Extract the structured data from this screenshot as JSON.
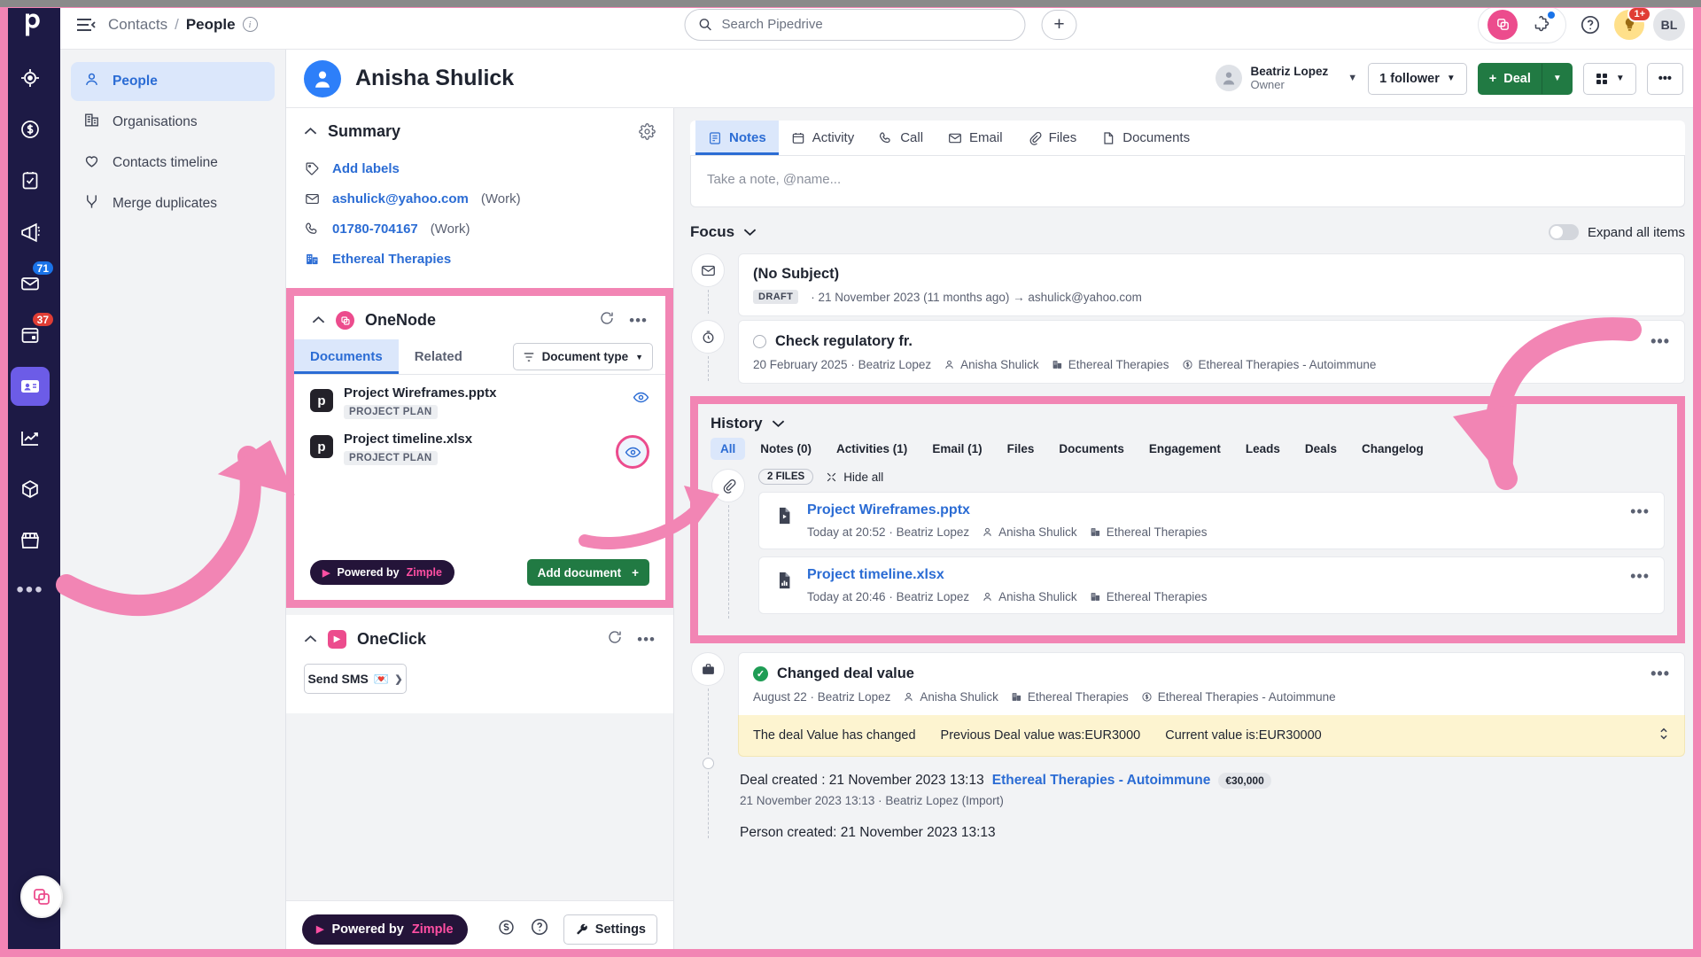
{
  "topbar": {
    "breadcrumb_parent": "Contacts",
    "breadcrumb_sep": "/",
    "breadcrumb_current": "People",
    "search_placeholder": "Search Pipedrive",
    "plus_label": "+",
    "help_label": "?",
    "notifications_badge": "1+",
    "user_initials": "BL"
  },
  "rail": {
    "badge_mail": "71",
    "badge_calendar": "37",
    "more_label": "•••"
  },
  "leftnav": {
    "items": [
      {
        "label": "People",
        "icon": "person-icon",
        "active": true
      },
      {
        "label": "Organisations",
        "icon": "building-icon",
        "active": false
      },
      {
        "label": "Contacts timeline",
        "icon": "heart-icon",
        "active": false
      },
      {
        "label": "Merge duplicates",
        "icon": "merge-icon",
        "active": false
      }
    ]
  },
  "person": {
    "name": "Anisha Shulick",
    "owner_name": "Beatriz Lopez",
    "owner_role": "Owner",
    "followers_label": "1 follower",
    "deal_label": "Deal",
    "deal_plus": "+"
  },
  "summary": {
    "title": "Summary",
    "add_labels": "Add labels",
    "email": "ashulick@yahoo.com",
    "email_type": "(Work)",
    "phone": "01780-704167",
    "phone_type": "(Work)",
    "organisation": "Ethereal Therapies"
  },
  "onenode": {
    "title": "OneNode",
    "tabs": [
      {
        "label": "Documents",
        "active": true
      },
      {
        "label": "Related",
        "active": false
      }
    ],
    "document_type_filter": "Document type",
    "documents": [
      {
        "name": "Project Wireframes.pptx",
        "tag": "PROJECT PLAN",
        "highlighted": false
      },
      {
        "name": "Project timeline.xlsx",
        "tag": "PROJECT PLAN",
        "highlighted": true
      }
    ],
    "powered_by_prefix": "Powered by",
    "powered_by_brand": "Zimple",
    "add_document": "Add document",
    "add_document_plus": "+"
  },
  "oneclick": {
    "title": "OneClick",
    "send_sms": "Send SMS",
    "send_sms_emoji": "💌"
  },
  "center_footer": {
    "powered_by_prefix": "Powered by",
    "powered_by_brand": "Zimple",
    "settings": "Settings"
  },
  "nav_tabs": [
    {
      "label": "Notes",
      "icon": "note-icon",
      "active": true
    },
    {
      "label": "Activity",
      "icon": "calendar-icon",
      "active": false
    },
    {
      "label": "Call",
      "icon": "phone-icon",
      "active": false
    },
    {
      "label": "Email",
      "icon": "envelope-icon",
      "active": false
    },
    {
      "label": "Files",
      "icon": "paperclip-icon",
      "active": false
    },
    {
      "label": "Documents",
      "icon": "document-icon",
      "active": false
    }
  ],
  "note_input": {
    "placeholder": "Take a note, @name..."
  },
  "focus": {
    "title": "Focus",
    "expand_all": "Expand all items",
    "items": [
      {
        "icon": "envelope-icon",
        "title": "(No Subject)",
        "tag": "DRAFT",
        "meta": "· 21 November 2023 (11 months ago) → ashulick@yahoo.com",
        "has_menu": false
      },
      {
        "icon": "clock-icon",
        "title": "Check regulatory fr.",
        "date": "20 February 2025 · Beatriz Lopez",
        "person": "Anisha Shulick",
        "org": "Ethereal Therapies",
        "deal": "Ethereal Therapies - Autoimmune",
        "has_menu": true
      }
    ]
  },
  "history": {
    "title": "History",
    "filters": [
      {
        "label": "All",
        "active": true
      },
      {
        "label": "Notes (0)",
        "active": false
      },
      {
        "label": "Activities (1)",
        "active": false
      },
      {
        "label": "Email (1)",
        "active": false
      },
      {
        "label": "Files",
        "active": false
      },
      {
        "label": "Documents",
        "active": false
      },
      {
        "label": "Engagement",
        "active": false
      },
      {
        "label": "Leads",
        "active": false
      },
      {
        "label": "Deals",
        "active": false
      },
      {
        "label": "Changelog",
        "active": false
      }
    ],
    "files_group": {
      "count_label": "2 FILES",
      "hide_all": "Hide all",
      "files": [
        {
          "name": "Project Wireframes.pptx",
          "time": "Today at 20:52 · Beatriz Lopez",
          "person": "Anisha Shulick",
          "org": "Ethereal Therapies",
          "icon": "pptx-file-icon"
        },
        {
          "name": "Project timeline.xlsx",
          "time": "Today at 20:46 · Beatriz Lopez",
          "person": "Anisha Shulick",
          "org": "Ethereal Therapies",
          "icon": "xlsx-file-icon"
        }
      ]
    },
    "deal_change": {
      "title": "Changed deal value",
      "date": "August 22 · Beatriz Lopez",
      "person": "Anisha Shulick",
      "org": "Ethereal Therapies",
      "deal": "Ethereal Therapies - Autoimmune",
      "note_1": "The deal Value has changed",
      "note_2": "Previous Deal value was:EUR3000",
      "note_3": "Current value is:EUR30000"
    },
    "deal_created": {
      "prefix": "Deal created : 21 November 2023 13:13",
      "link": "Ethereal Therapies - Autoimmune",
      "amount": "€30,000",
      "sub": "21 November 2023 13:13 · Beatriz Lopez (Import)"
    },
    "person_created": {
      "text": "Person created: 21 November 2023 13:13"
    }
  },
  "colors": {
    "pink_highlight": "#f285b4",
    "brand_pink": "#ec4c8d",
    "green": "#217a43",
    "link_blue": "#2b6cd4",
    "rail_bg": "#1d1a45"
  }
}
